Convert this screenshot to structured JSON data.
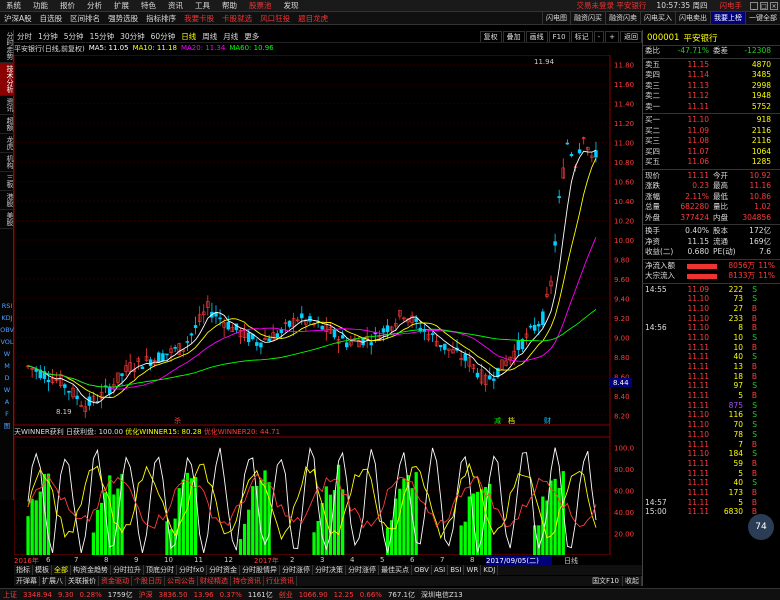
{
  "menubar": {
    "items": [
      "系统",
      "功能",
      "报价",
      "分析",
      "扩展",
      "特色",
      "资讯",
      "工具",
      "帮助"
    ],
    "promo": "股票池",
    "promo2": "发现",
    "center": "交易未登录  平安银行",
    "clock": "10:57:35 周四",
    "hotline": "闪电手"
  },
  "toolbar": {
    "items": [
      "沪深A股",
      "自选股",
      "区间排名",
      "强势选股",
      "指标排序"
    ],
    "red_items": [
      "我要卡股",
      "卡股就选",
      "风口狂投",
      "题目龙虎"
    ],
    "right_items": [
      "闪电图",
      "融资闪买",
      "融资闪卖",
      "闪电买入",
      "闪电卖出"
    ],
    "login": "我要上榜",
    "end": "一键全部"
  },
  "left_tabs": [
    "分时走势",
    "技术分析",
    "资讯",
    "超额",
    "龙虎",
    "机构",
    "三板",
    "港股",
    "美股",
    "指数",
    "全部",
    "自选"
  ],
  "left_symbols": [
    "RSI",
    "KDJ",
    "OBV",
    "VOL",
    "W",
    "M",
    "D",
    "W",
    "A",
    "F",
    "图"
  ],
  "periods": [
    "分时",
    "1分钟",
    "5分钟",
    "15分钟",
    "30分钟",
    "60分钟",
    "日线",
    "周线",
    "月线",
    "更多"
  ],
  "period_active": "日线",
  "period_right": [
    "复权",
    "叠加",
    "画线",
    "F10",
    "标记",
    "-",
    "+",
    "返回"
  ],
  "ma_legend": {
    "title": "平安银行(日线,前复权)",
    "ma5": "MA5: 11.05",
    "ma10": "MA10: 11.18",
    "ma20": "MA20: 11.34",
    "ma60": "MA60: 10.96"
  },
  "price_axis": [
    "11.80",
    "11.60",
    "11.40",
    "11.20",
    "11.00",
    "10.80",
    "10.60",
    "10.40",
    "10.20",
    "10.00",
    "9.80",
    "9.60",
    "9.40",
    "9.20",
    "9.00",
    "8.80",
    "8.60",
    "8.40",
    "8.20"
  ],
  "chart_labels": {
    "high": "11.94",
    "low": "8.19",
    "cur_price": "8.44",
    "mark_red": "杀",
    "marks": [
      "减",
      "档",
      "财"
    ]
  },
  "indicator": {
    "name": "天WINNER获利",
    "sub": "日获利盘: 100.00",
    "w15": "优化WINNER15: 80.28",
    "w20": "优化WINNER20: 44.71",
    "axis": [
      "100.0",
      "80.00",
      "60.00",
      "40.00",
      "20.00"
    ]
  },
  "date_axis": [
    "2016年",
    "6",
    "7",
    "8",
    "9",
    "10",
    "11",
    "12",
    "2017年",
    "2",
    "3",
    "4",
    "5",
    "6",
    "7",
    "8",
    "2017/09/05(二)",
    "日线"
  ],
  "tabs1": [
    "指标",
    "模板",
    "全部",
    "构资金趋势",
    "分时拉升",
    "顶底分时",
    "分时fx0",
    "分时资金",
    "分时股情异",
    "分时涨停",
    "分时决策",
    "分时涨停",
    "最佳买点",
    "OBV",
    "ASI",
    "BSI",
    "WR",
    "KDJ"
  ],
  "tabs2": [
    "开弹幕",
    "扩展八",
    "关联报价",
    "资金驱动",
    "个股日历",
    "公司公告",
    "财经精选",
    "持仓资讯",
    "行业资讯"
  ],
  "tabs2_right": [
    "国文F10",
    "收起"
  ],
  "statusbar": {
    "sh_label": "上证",
    "sh_val": "3348.94",
    "sh_chg": "9.30",
    "sh_pct": "0.28%",
    "sh_amt": "1759亿",
    "sz_label": "沪深",
    "sz_val": "3836.50",
    "sz_chg": "13.96",
    "sz_pct": "0.37%",
    "sz_amt": "1161亿",
    "cy_label": "创业",
    "cy_val": "1066.90",
    "cy_chg": "12.25",
    "cy_pct": "0.66%",
    "cy_amt": "767.1亿",
    "server": "深圳电信Z13"
  },
  "stock": {
    "code": "000001",
    "name": "平安银行",
    "weibi_label": "委比",
    "weibi": "-47.71%",
    "weicha_label": "委差",
    "weicha": "-12308",
    "asks": [
      {
        "label": "卖五",
        "price": "11.15",
        "vol": "4870"
      },
      {
        "label": "卖四",
        "price": "11.14",
        "vol": "3485"
      },
      {
        "label": "卖三",
        "price": "11.13",
        "vol": "2998"
      },
      {
        "label": "卖二",
        "price": "11.12",
        "vol": "1948"
      },
      {
        "label": "卖一",
        "price": "11.11",
        "vol": "5752"
      }
    ],
    "bids": [
      {
        "label": "买一",
        "price": "11.10",
        "vol": "918"
      },
      {
        "label": "买二",
        "price": "11.09",
        "vol": "2116"
      },
      {
        "label": "买三",
        "price": "11.08",
        "vol": "2116"
      },
      {
        "label": "买四",
        "price": "11.07",
        "vol": "1064"
      },
      {
        "label": "买五",
        "price": "11.06",
        "vol": "1285"
      }
    ],
    "stats": [
      {
        "l1": "现价",
        "v1": "11.11",
        "l2": "今开",
        "v2": "10.92"
      },
      {
        "l1": "涨跌",
        "v1": "0.23",
        "l2": "最高",
        "v2": "11.16"
      },
      {
        "l1": "涨幅",
        "v1": "2.11%",
        "l2": "最低",
        "v2": "10.86"
      },
      {
        "l1": "总量",
        "v1": "682280",
        "l2": "量比",
        "v2": "1.02"
      },
      {
        "l1": "外盘",
        "v1": "377424",
        "l2": "内盘",
        "v2": "304856"
      }
    ],
    "stats2": [
      {
        "l1": "换手",
        "v1": "0.40%",
        "l2": "股本",
        "v2": "172亿"
      },
      {
        "l1": "净资",
        "v1": "11.15",
        "l2": "流通",
        "v2": "169亿"
      },
      {
        "l1": "收益(二)",
        "v1": "0.680",
        "l2": "PE(动)",
        "v2": "7.6"
      }
    ],
    "flow": [
      {
        "l": "净流入额",
        "v": "8056万",
        "p": "11%"
      },
      {
        "l": "大宗流入",
        "v": "8133万",
        "p": "11%"
      }
    ],
    "ticks": [
      {
        "t": "14:55",
        "p": "11.09",
        "v": "222",
        "f": "S"
      },
      {
        "t": "",
        "p": "11.10",
        "v": "73",
        "f": "S"
      },
      {
        "t": "",
        "p": "11.10",
        "v": "27",
        "f": "B"
      },
      {
        "t": "",
        "p": "11.10",
        "v": "233",
        "f": "B"
      },
      {
        "t": "14:56",
        "p": "11.10",
        "v": "8",
        "f": "B"
      },
      {
        "t": "",
        "p": "11.10",
        "v": "10",
        "f": "S"
      },
      {
        "t": "",
        "p": "11.11",
        "v": "10",
        "f": "B"
      },
      {
        "t": "",
        "p": "11.11",
        "v": "40",
        "f": "S"
      },
      {
        "t": "",
        "p": "11.11",
        "v": "13",
        "f": "B"
      },
      {
        "t": "",
        "p": "11.11",
        "v": "18",
        "f": "B"
      },
      {
        "t": "",
        "p": "11.11",
        "v": "97",
        "f": "S"
      },
      {
        "t": "",
        "p": "11.11",
        "v": "5",
        "f": "B"
      },
      {
        "t": "",
        "p": "11.11",
        "v": "875",
        "f": "S"
      },
      {
        "t": "",
        "p": "11.10",
        "v": "116",
        "f": "S"
      },
      {
        "t": "",
        "p": "11.10",
        "v": "70",
        "f": "S"
      },
      {
        "t": "",
        "p": "11.10",
        "v": "78",
        "f": "S"
      },
      {
        "t": "",
        "p": "11.11",
        "v": "7",
        "f": "B"
      },
      {
        "t": "",
        "p": "11.10",
        "v": "184",
        "f": "S"
      },
      {
        "t": "",
        "p": "11.11",
        "v": "59",
        "f": "B"
      },
      {
        "t": "",
        "p": "11.11",
        "v": "5",
        "f": "B"
      },
      {
        "t": "",
        "p": "11.11",
        "v": "40",
        "f": "S"
      },
      {
        "t": "",
        "p": "11.11",
        "v": "173",
        "f": "B"
      },
      {
        "t": "14:57",
        "p": "11.11",
        "v": "5",
        "f": "B"
      },
      {
        "t": "15:00",
        "p": "11.11",
        "v": "6830",
        "f": "B"
      }
    ],
    "badge": "74",
    "badge_pct": "74%"
  }
}
